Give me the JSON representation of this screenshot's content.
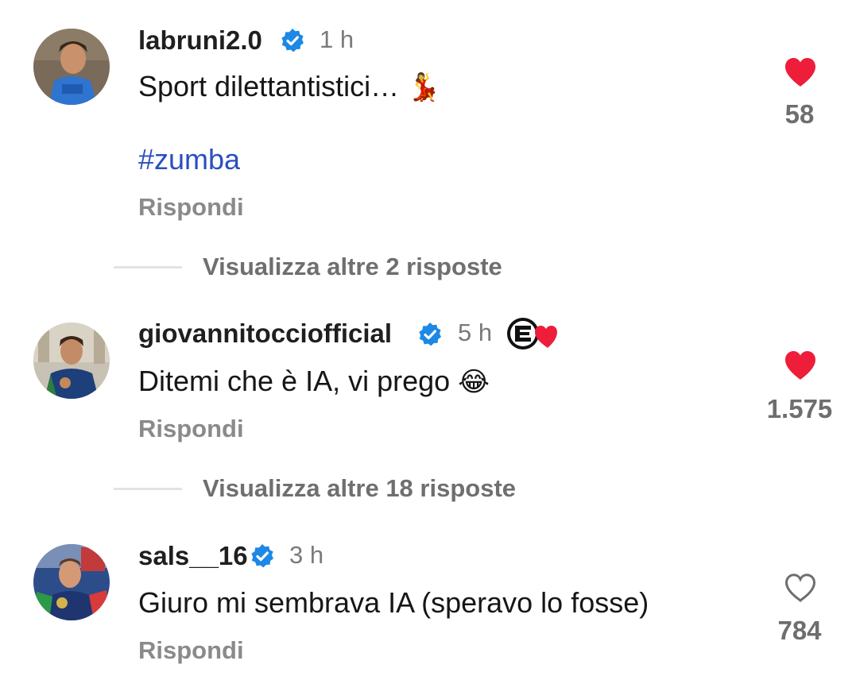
{
  "comments": [
    {
      "username": "labruni2.0",
      "time": "1 h",
      "text": "Sport dilettantistici…",
      "emoji": "💃",
      "hashtag": "#zumba",
      "reply_label": "Rispondi",
      "likes": "58",
      "liked": true,
      "more_replies": "Visualizza altre 2 risposte"
    },
    {
      "username": "giovannitocciofficial",
      "time": "5 h",
      "text": "Ditemi che è IA, vi prego",
      "emoji": "😂",
      "reply_label": "Rispondi",
      "likes": "1.575",
      "liked": true,
      "creator_liked": true,
      "more_replies": "Visualizza altre 18 risposte"
    },
    {
      "username": "sals__16",
      "time": "3 h",
      "text": "Giuro mi sembrava IA (speravo lo fosse)",
      "reply_label": "Rispondi",
      "likes": "784",
      "liked": false
    }
  ],
  "colors": {
    "verified": "#1d88e5",
    "heart_liked": "#ee1d3a",
    "hashtag": "#2b4fbf",
    "muted": "#8a8a8a"
  },
  "icons": [
    "verified-badge-icon",
    "heart-filled-icon",
    "heart-outline-icon",
    "creator-liked-badge-icon"
  ]
}
